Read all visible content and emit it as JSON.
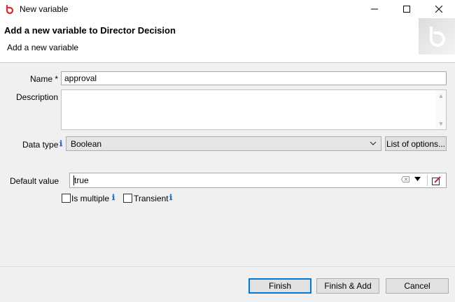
{
  "window": {
    "title": "New variable",
    "icon": "bonita-logo-icon",
    "controls": [
      "minimize-icon",
      "maximize-icon",
      "close-icon"
    ]
  },
  "banner": {
    "heading": "Add a new variable to Director Decision",
    "subheading": "Add a new variable"
  },
  "form": {
    "name_label": "Name *",
    "name_value": "approval",
    "description_label": "Description",
    "description_value": "",
    "datatype_label": "Data type",
    "datatype_value": "Boolean",
    "list_options_label": "List of options...",
    "default_label": "Default value",
    "default_value": "true",
    "is_multiple_label": "Is multiple",
    "is_multiple_checked": false,
    "transient_label": "Transient",
    "transient_checked": false,
    "info_glyph": "ℹ"
  },
  "footer": {
    "finish_label": "Finish",
    "finish_add_label": "Finish & Add",
    "cancel_label": "Cancel"
  },
  "colors": {
    "brand": "#e0282e",
    "info": "#2d6ecb",
    "focus": "#0078d7"
  }
}
